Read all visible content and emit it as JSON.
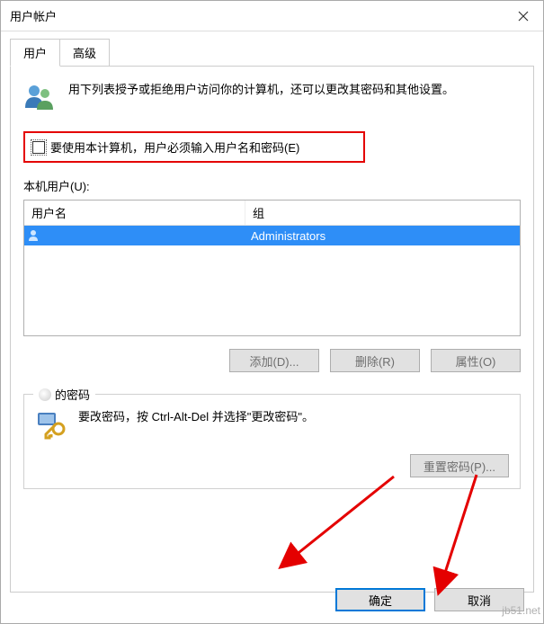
{
  "window": {
    "title": "用户帐户"
  },
  "tabs": {
    "users": "用户",
    "advanced": "高级"
  },
  "intro": "用下列表授予或拒绝用户访问你的计算机，还可以更改其密码和其他设置。",
  "checkbox": {
    "label": "要使用本计算机，用户必须输入用户名和密码(E)",
    "checked": false
  },
  "list": {
    "label": "本机用户(U):",
    "columns": {
      "name": "用户名",
      "group": "组"
    },
    "rows": [
      {
        "name": "",
        "group": "Administrators"
      }
    ]
  },
  "buttons": {
    "add": "添加(D)...",
    "remove": "删除(R)",
    "properties": "属性(O)"
  },
  "passwordSection": {
    "legend": "的密码",
    "text": "要改密码，按 Ctrl-Alt-Del 并选择\"更改密码\"。",
    "reset": "重置密码(P)..."
  },
  "footer": {
    "ok": "确定",
    "cancel": "取消"
  },
  "watermark": "jb51.net"
}
